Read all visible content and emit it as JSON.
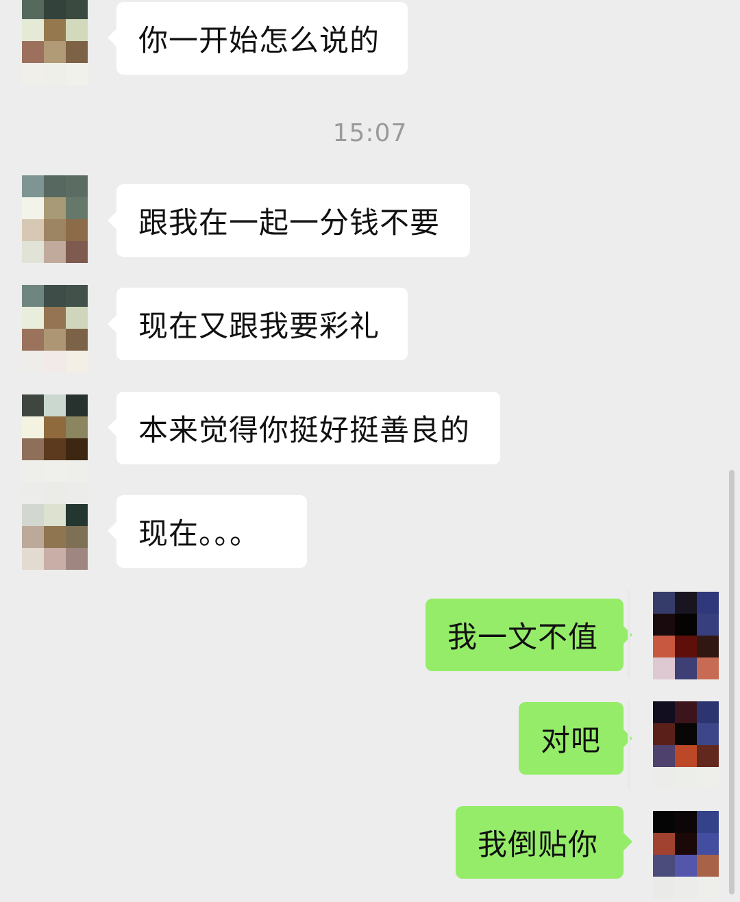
{
  "timestamp": "15:07",
  "received": [
    {
      "text": "你一开始怎么说的"
    },
    {
      "text": "跟我在一起一分钱不要"
    },
    {
      "text": "现在又跟我要彩礼"
    },
    {
      "text": "本来觉得你挺好挺善良的"
    },
    {
      "text": "现在。。。"
    }
  ],
  "sent": [
    {
      "text": "我一文不值"
    },
    {
      "text": "对吧"
    },
    {
      "text": "我倒贴你"
    }
  ],
  "colors": {
    "chat_background": "#ededed",
    "received_bubble": "#ffffff",
    "sent_bubble": "#95ec69",
    "timestamp_text": "#9a9a9a"
  },
  "avatars": {
    "contact": "pixelated-avatar",
    "self": "pixelated-avatar"
  }
}
